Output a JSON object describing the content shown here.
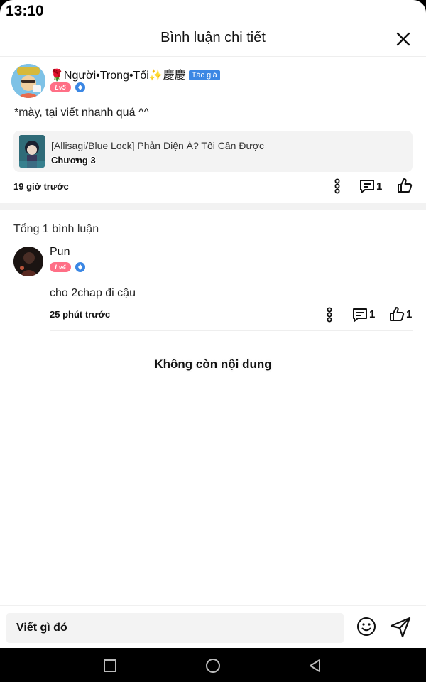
{
  "status_bar": {
    "time": "13:10"
  },
  "header": {
    "title": "Bình luận chi tiết",
    "close_icon": "close-icon"
  },
  "post": {
    "username": "🌹Người•Trong•Tối✨慶慶",
    "author_tag": "Tác giả",
    "level": "Lv5",
    "text": "*mày, tại viết nhanh quá ^^",
    "work": {
      "title": "[Allisagi/Blue Lock] Phản Diện Á? Tôi Cân Được",
      "chapter": "Chương 3"
    },
    "time": "19 giờ trước",
    "reply_count": "1"
  },
  "comments": {
    "total_label": "Tổng 1 bình luận",
    "items": [
      {
        "username": "Pun",
        "level": "Lv4",
        "text": "cho 2chap đi cậu",
        "time": "25 phút trước",
        "reply_count": "1",
        "like_count": "1"
      }
    ],
    "end_label": "Không còn nội dung"
  },
  "composer": {
    "placeholder": "Viết gì đó"
  },
  "colors": {
    "level_badge": "#ff6f86",
    "author_tag": "#3b87e4",
    "verify": "#3b87e4"
  }
}
